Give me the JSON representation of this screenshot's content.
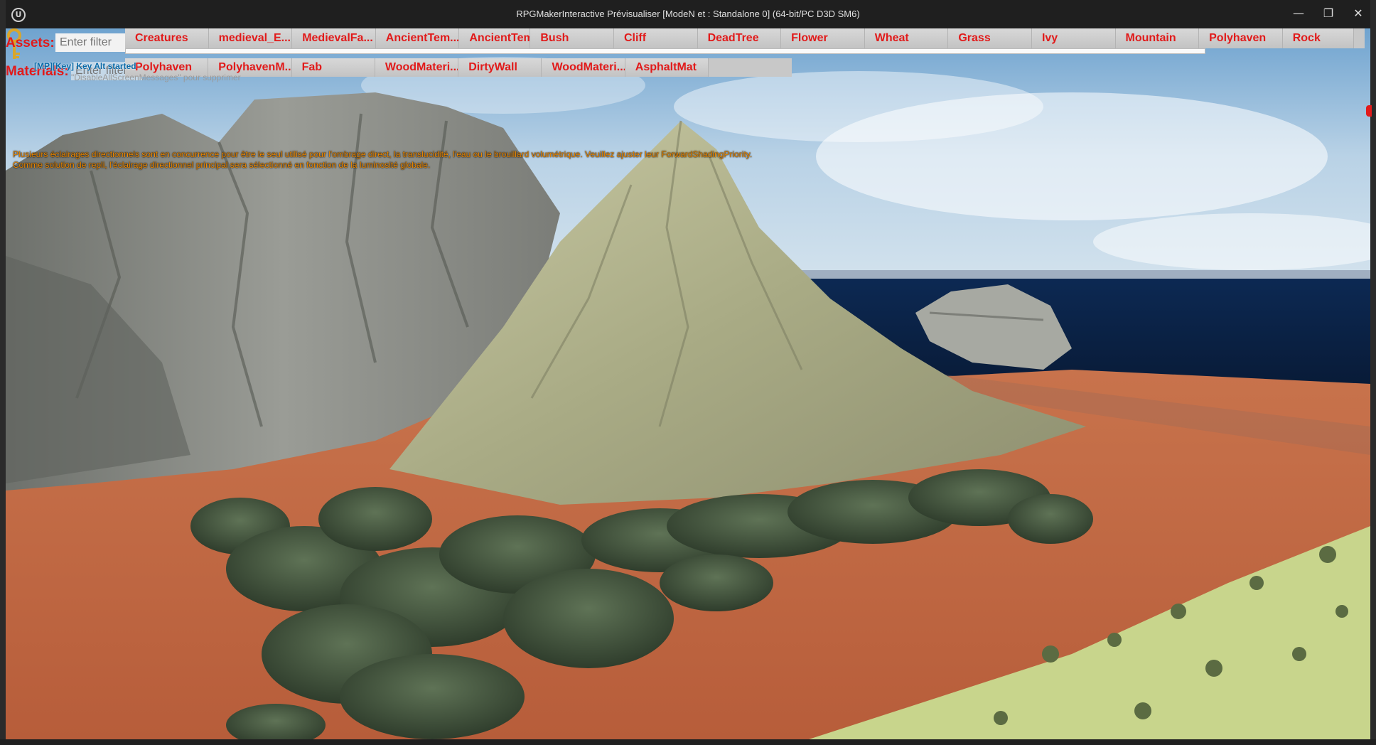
{
  "window": {
    "title": "RPGMakerInteractive Prévisualiser [ModeN et : Standalone 0]  (64-bit/PC D3D SM6)",
    "logo_glyph": "U",
    "controls": {
      "minimize": "—",
      "maximize": "❐",
      "close": "✕"
    }
  },
  "assets": {
    "label": "Assets:",
    "filter_placeholder": "Enter filter",
    "buttons": [
      "Creatures",
      "medieval_E...",
      "MedievalFa...",
      "AncientTem...",
      "AncientTem...",
      "Bush",
      "Cliff",
      "DeadTree",
      "Flower",
      "Wheat",
      "Grass",
      "Ivy",
      "Mountain",
      "Polyhaven",
      "Rock"
    ]
  },
  "materials": {
    "label": "Materials:",
    "filter_placeholder": "Enter filter",
    "buttons": [
      "Polyhaven",
      "PolyhavenM...",
      "Fab",
      "WoodMateri...",
      "DirtyWall",
      "WoodMateri...",
      "AsphaltMat"
    ]
  },
  "debug": {
    "message": "[MP][Key] Key Alt started",
    "hint": "\"DisableAllScreenMessages\" pour supprimer"
  },
  "warning": {
    "line1": "Plusieurs éclairages directionnels sont en concurrence pour être le seul utilisé pour l'ombrage direct, la translucidité, l'eau ou le brouillard volumétrique. Veuillez ajuster leur ForwardShadingPriority.",
    "line2": "Comme solution de repli, l'éclairage directionnel principal sera sélectionné en fonction de la luminosité globale."
  },
  "colors": {
    "ui_red": "#e11a1a",
    "warning_orange": "#f08a00",
    "debug_blue": "#0a6aa8",
    "ground": "#c8704a",
    "grass": "#c9d68a"
  }
}
